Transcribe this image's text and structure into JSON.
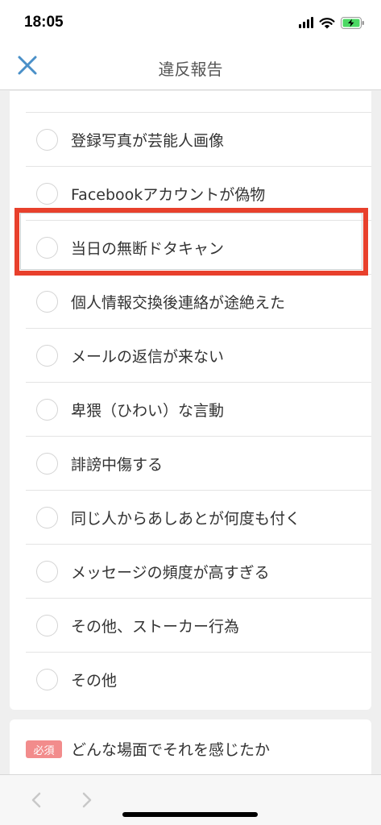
{
  "status_bar": {
    "time": "18:05",
    "icons": [
      "signal-icon",
      "wifi-icon",
      "battery-charging-icon"
    ]
  },
  "nav": {
    "title": "違反報告",
    "close_icon": "close-icon"
  },
  "options": [
    {
      "label": "登録写真が芸能人画像",
      "selected": false
    },
    {
      "label": "Facebookアカウントが偽物",
      "selected": false
    },
    {
      "label": "当日の無断ドタキャン",
      "selected": false,
      "highlighted": true
    },
    {
      "label": "個人情報交換後連絡が途絶えた",
      "selected": false
    },
    {
      "label": "メールの返信が来ない",
      "selected": false
    },
    {
      "label": "卑猥（ひわい）な言動",
      "selected": false
    },
    {
      "label": "誹謗中傷する",
      "selected": false
    },
    {
      "label": "同じ人からあしあとが何度も付く",
      "selected": false
    },
    {
      "label": "メッセージの頻度が高すぎる",
      "selected": false
    },
    {
      "label": "その他、ストーカー行為",
      "selected": false
    },
    {
      "label": "その他",
      "selected": false
    }
  ],
  "required_section": {
    "badge": "必須",
    "question": "どんな場面でそれを感じたか"
  },
  "toolbar": {
    "back_icon": "chevron-left-icon",
    "forward_icon": "chevron-right-icon"
  },
  "colors": {
    "accent": "#4a90c8",
    "highlight": "#e8402c",
    "badge": "#f28c8c",
    "background": "#efefef"
  }
}
